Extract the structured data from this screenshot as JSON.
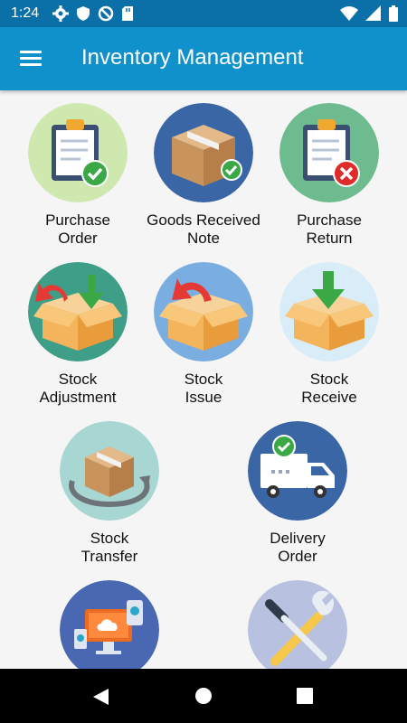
{
  "status_bar": {
    "time": "1:24",
    "left_icons": [
      "gear-icon",
      "shield-icon",
      "no-sign-icon",
      "sd-card-icon"
    ],
    "right_icons": [
      "wifi-icon",
      "signal-icon",
      "battery-icon"
    ]
  },
  "app_bar": {
    "menu_icon": "hamburger-menu-icon",
    "title": "Inventory Management"
  },
  "tiles": [
    {
      "id": "purchase-order",
      "label": "Purchase\nOrder",
      "icon": "clipboard-check-icon",
      "bg": "#cfe8b0"
    },
    {
      "id": "goods-received-note",
      "label": "Goods Received\nNote",
      "icon": "box-check-icon",
      "bg": "#3a66a6"
    },
    {
      "id": "purchase-return",
      "label": "Purchase\nReturn",
      "icon": "clipboard-x-icon",
      "bg": "#6dbb8f"
    },
    {
      "id": "stock-adjustment",
      "label": "Stock\nAdjustment",
      "icon": "box-arrows-icon",
      "bg": "#3e9e88"
    },
    {
      "id": "stock-issue",
      "label": "Stock\nIssue",
      "icon": "box-red-arrow-icon",
      "bg": "#7aaee0"
    },
    {
      "id": "stock-receive",
      "label": "Stock\nReceive",
      "icon": "box-green-arrow-icon",
      "bg": "#d9edf8"
    },
    {
      "id": "stock-transfer",
      "label": "Stock\nTransfer",
      "icon": "box-transfer-icon",
      "bg": "#a8d6d2"
    },
    {
      "id": "delivery-order",
      "label": "Delivery\nOrder",
      "icon": "delivery-truck-icon",
      "bg": "#3a66a6"
    },
    {
      "id": "sync",
      "label": "",
      "icon": "devices-sync-icon",
      "bg": "#4a68b2"
    },
    {
      "id": "settings",
      "label": "",
      "icon": "wrench-screwdriver-icon",
      "bg": "#b8c2e0"
    }
  ],
  "nav_bar": {
    "back_icon": "back-triangle-icon",
    "home_icon": "home-circle-icon",
    "recent_icon": "recent-square-icon"
  },
  "colors": {
    "status_bar": "#0b6fa8",
    "app_bar": "#1091cc",
    "background": "#f5f5f5"
  }
}
